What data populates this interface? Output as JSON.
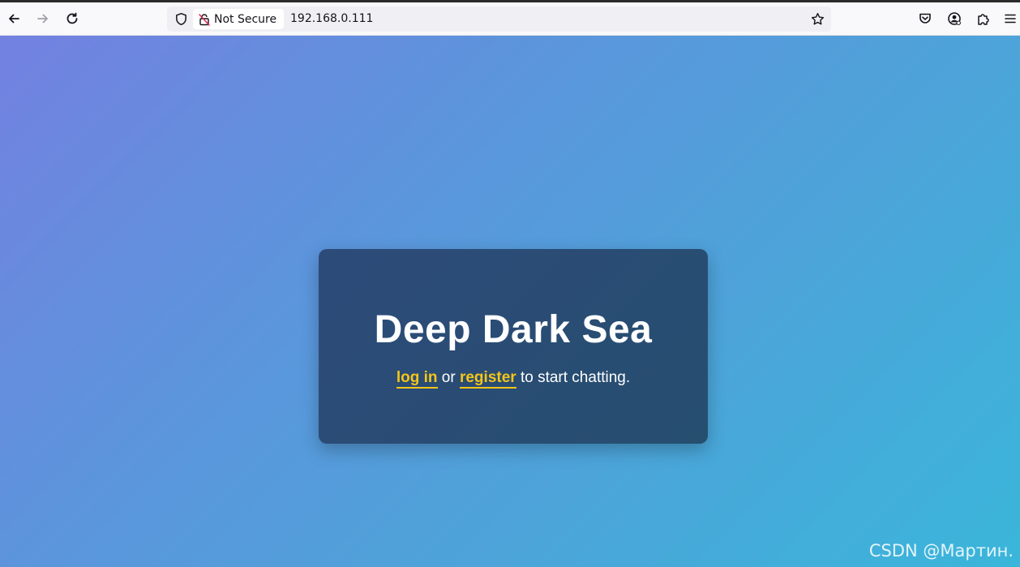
{
  "browser": {
    "security_label": "Not Secure",
    "url": "192.168.0.111",
    "icons": {
      "back": "arrow-left-icon",
      "forward": "arrow-right-icon",
      "reload": "reload-icon",
      "tracking": "shield-icon",
      "insecure": "insecure-lock-icon",
      "bookmark": "star-icon",
      "pocket": "pocket-icon",
      "account": "account-icon",
      "extensions": "puzzle-icon",
      "menu": "hamburger-menu-icon"
    }
  },
  "page": {
    "title": "Deep Dark Sea",
    "login_link": "log in",
    "or_text": " or ",
    "register_link": "register",
    "suffix_text": " to start chatting.",
    "colors": {
      "link": "#f5c518",
      "card": "#2d4b79",
      "gradient_start": "#7381e0",
      "gradient_end": "#3ab6da"
    }
  },
  "watermark": "CSDN @Мартин."
}
